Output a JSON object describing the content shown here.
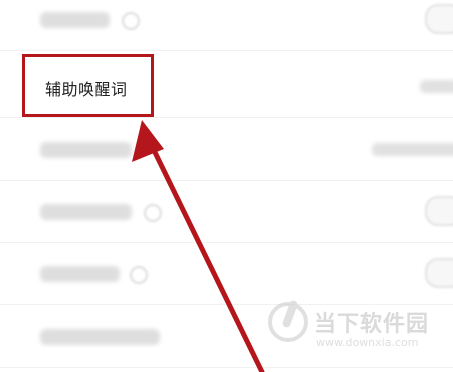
{
  "settings": {
    "highlighted_item_label": "辅助唤醒词"
  },
  "watermark": {
    "title": "当下软件园",
    "url": "www.downxia.com"
  },
  "colors": {
    "highlight": "#b5161b",
    "arrow": "#b5161b"
  },
  "icons": {
    "arrow": "red-pointer-arrow-icon",
    "watermark_logo": "downxia-logo-icon"
  }
}
